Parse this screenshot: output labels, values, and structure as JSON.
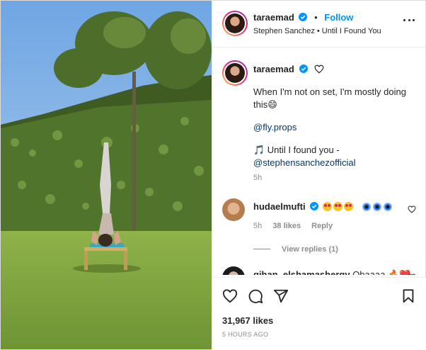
{
  "header": {
    "username": "taraemad",
    "separator": "•",
    "follow_label": "Follow",
    "subline": "Stephen Sanchez • Until I Found You"
  },
  "caption": {
    "username": "taraemad",
    "line1": "When I'm not on set, I'm mostly doing this😄",
    "mention": "@fly.props",
    "music_line1": "🎵 Until I found you -",
    "music_line2": "@stephensanchezofficial",
    "time": "5h"
  },
  "comments": [
    {
      "username": "hudaelmufti",
      "time": "5h",
      "likes": "38 likes",
      "reply": "Reply",
      "view_replies": "View replies (1)"
    },
    {
      "username": "gihan_elshamashergy",
      "text": "Obaaaa 🔥❤️"
    }
  ],
  "footer": {
    "likes": "31,967 likes",
    "ago": "5 HOURS AGO"
  },
  "colors": {
    "accent": "#0095f6",
    "link": "#00376b",
    "muted": "#8e8e8e"
  },
  "icons": [
    "verified-icon",
    "more-icon",
    "heart-icon",
    "comment-icon",
    "share-icon",
    "bookmark-icon"
  ]
}
